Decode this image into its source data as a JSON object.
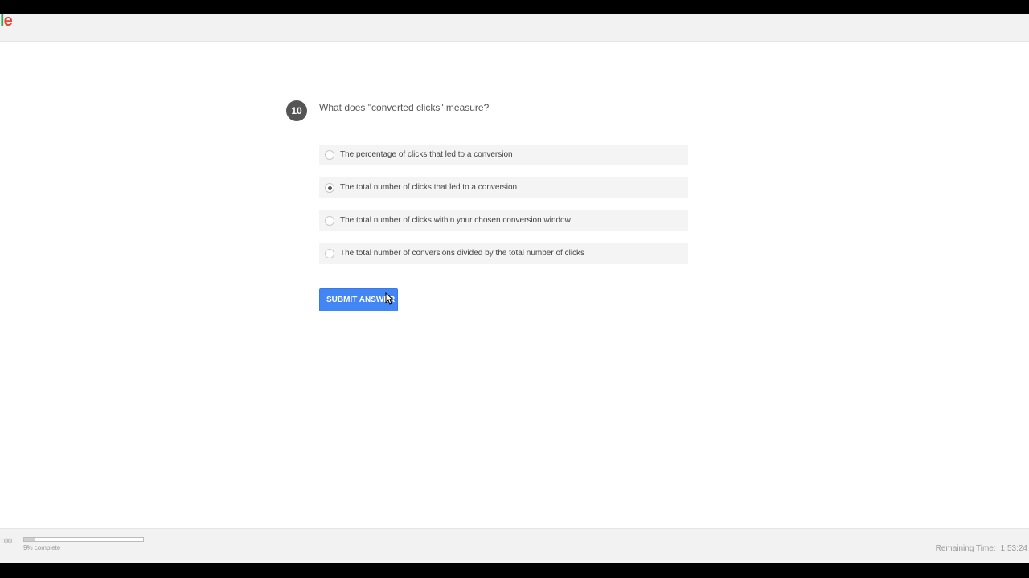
{
  "header": {
    "logo_part1": "l",
    "logo_part2": "e"
  },
  "question": {
    "number": "10",
    "text": "What does \"converted clicks\" measure?"
  },
  "options": [
    {
      "label": "The percentage of clicks that led to a conversion",
      "selected": false
    },
    {
      "label": "The total number of clicks that led to a conversion",
      "selected": true
    },
    {
      "label": "The total number of clicks within your chosen conversion window",
      "selected": false
    },
    {
      "label": "The total number of conversions divided by the total number of clicks",
      "selected": false
    }
  ],
  "submit": {
    "label": "SUBMIT ANSWER"
  },
  "footer": {
    "page_count": "100",
    "progress_percent": 9,
    "progress_label": "9% complete",
    "remaining_label": "Remaining Time:",
    "remaining_value": "1:53:24"
  },
  "colors": {
    "accent": "#4285f4",
    "badge": "#555555",
    "logo_green": "#34a853",
    "logo_red": "#ea4335"
  }
}
